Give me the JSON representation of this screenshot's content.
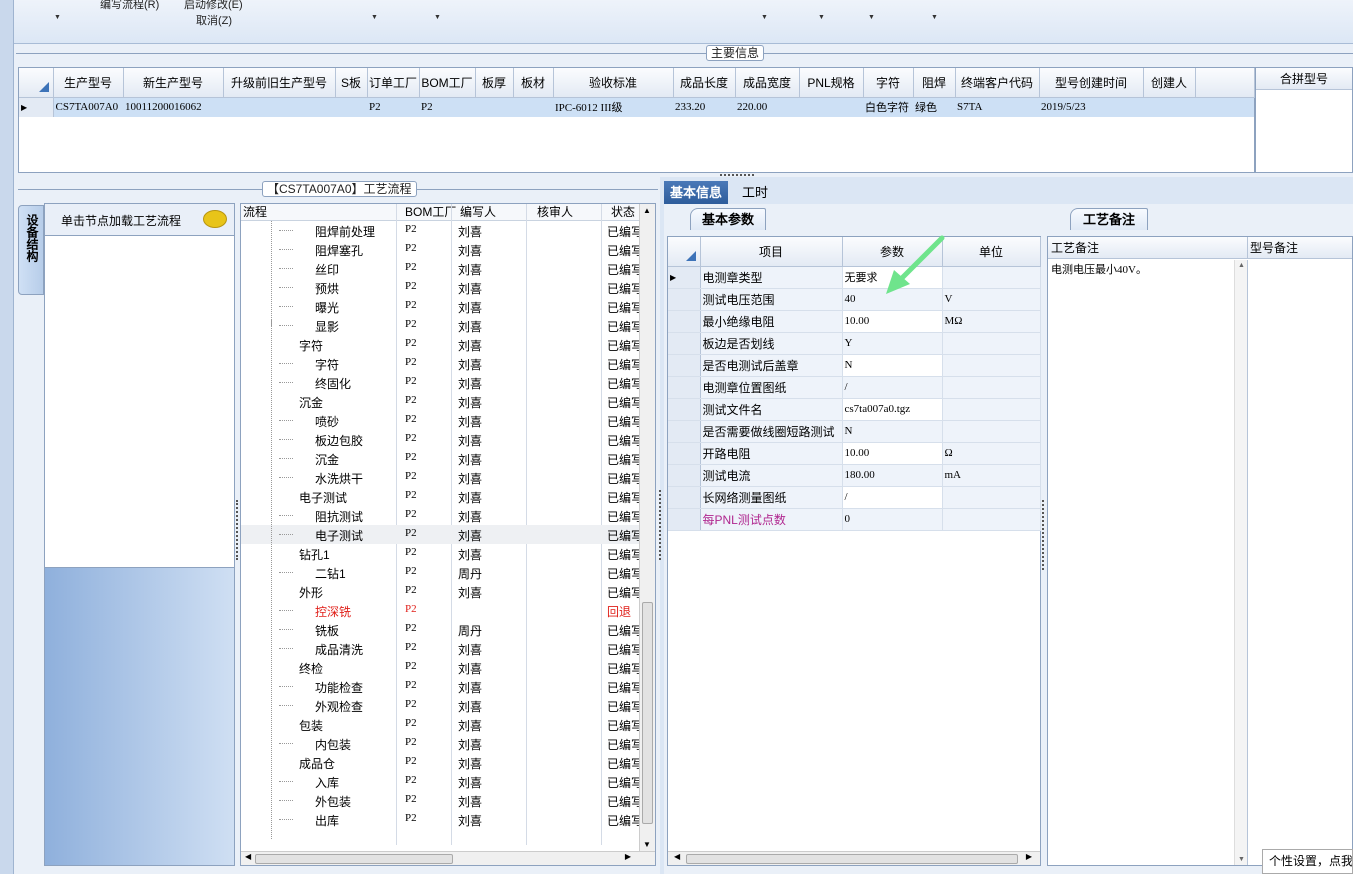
{
  "toolbar": {
    "items": [
      "编写流程(R)",
      "启动修改(E)",
      "取消(Z)"
    ]
  },
  "main_info": {
    "title": "主要信息",
    "columns": [
      "生产型号",
      "新生产型号",
      "升级前旧生产型号",
      "S板",
      "订单工厂",
      "BOM工厂",
      "板厚",
      "板材",
      "验收标准",
      "成品长度",
      "成品宽度",
      "PNL规格",
      "字符",
      "阻焊",
      "终端客户代码",
      "型号创建时间",
      "创建人"
    ],
    "rows": [
      [
        "CS7TA007A0",
        "10011200016062",
        "",
        "",
        "P2",
        "P2",
        "",
        "",
        "IPC-6012 III级",
        "233.20",
        "220.00",
        "",
        "白色字符",
        "绿色",
        "S7TA",
        "2019/5/23",
        ""
      ]
    ],
    "merge_title": "合拼型号"
  },
  "side_tab": "设备结构",
  "node_panel": {
    "header": "单击节点加载工艺流程"
  },
  "flow_panel": {
    "title": "【CS7TA007A0】工艺流程",
    "columns": [
      "流程",
      "BOM工厂",
      "编写人",
      "核审人",
      "状态"
    ],
    "rows": [
      {
        "name": "阻焊前处理",
        "level": 2,
        "type": "file",
        "bom": "P2",
        "writer": "刘喜",
        "reviewer": "",
        "status": "已编写",
        "red": false
      },
      {
        "name": "阻焊塞孔",
        "level": 2,
        "type": "file",
        "bom": "P2",
        "writer": "刘喜",
        "reviewer": "",
        "status": "已编写",
        "red": false
      },
      {
        "name": "丝印",
        "level": 2,
        "type": "file",
        "bom": "P2",
        "writer": "刘喜",
        "reviewer": "",
        "status": "已编写",
        "red": false
      },
      {
        "name": "预烘",
        "level": 2,
        "type": "file",
        "bom": "P2",
        "writer": "刘喜",
        "reviewer": "",
        "status": "已编写",
        "red": false
      },
      {
        "name": "曝光",
        "level": 2,
        "type": "file",
        "bom": "P2",
        "writer": "刘喜",
        "reviewer": "",
        "status": "已编写",
        "red": false
      },
      {
        "name": "显影",
        "level": 2,
        "type": "file",
        "bom": "P2",
        "writer": "刘喜",
        "reviewer": "",
        "status": "已编写",
        "red": false
      },
      {
        "name": "字符",
        "level": 1,
        "type": "folder",
        "bom": "P2",
        "writer": "刘喜",
        "reviewer": "",
        "status": "已编写",
        "red": false
      },
      {
        "name": "字符",
        "level": 2,
        "type": "file",
        "bom": "P2",
        "writer": "刘喜",
        "reviewer": "",
        "status": "已编写",
        "red": false
      },
      {
        "name": "终固化",
        "level": 2,
        "type": "file",
        "bom": "P2",
        "writer": "刘喜",
        "reviewer": "",
        "status": "已编写",
        "red": false
      },
      {
        "name": "沉金",
        "level": 1,
        "type": "folder",
        "bom": "P2",
        "writer": "刘喜",
        "reviewer": "",
        "status": "已编写",
        "red": false
      },
      {
        "name": "喷砂",
        "level": 2,
        "type": "file",
        "bom": "P2",
        "writer": "刘喜",
        "reviewer": "",
        "status": "已编写",
        "red": false
      },
      {
        "name": "板边包胶",
        "level": 2,
        "type": "file",
        "bom": "P2",
        "writer": "刘喜",
        "reviewer": "",
        "status": "已编写",
        "red": false
      },
      {
        "name": "沉金",
        "level": 2,
        "type": "file",
        "bom": "P2",
        "writer": "刘喜",
        "reviewer": "",
        "status": "已编写",
        "red": false
      },
      {
        "name": "水洗烘干",
        "level": 2,
        "type": "file",
        "bom": "P2",
        "writer": "刘喜",
        "reviewer": "",
        "status": "已编写",
        "red": false
      },
      {
        "name": "电子测试",
        "level": 1,
        "type": "folder",
        "bom": "P2",
        "writer": "刘喜",
        "reviewer": "",
        "status": "已编写",
        "red": false
      },
      {
        "name": "阻抗测试",
        "level": 2,
        "type": "file",
        "bom": "P2",
        "writer": "刘喜",
        "reviewer": "",
        "status": "已编写",
        "red": false
      },
      {
        "name": "电子测试",
        "level": 2,
        "type": "file",
        "bom": "P2",
        "writer": "刘喜",
        "reviewer": "",
        "status": "已编写",
        "red": false,
        "selected": true
      },
      {
        "name": "钻孔1",
        "level": 1,
        "type": "folder",
        "bom": "P2",
        "writer": "刘喜",
        "reviewer": "",
        "status": "已编写",
        "red": false
      },
      {
        "name": "二钻1",
        "level": 2,
        "type": "file",
        "bom": "P2",
        "writer": "周丹",
        "reviewer": "",
        "status": "已编写",
        "red": false
      },
      {
        "name": "外形",
        "level": 1,
        "type": "folder",
        "bom": "P2",
        "writer": "刘喜",
        "reviewer": "",
        "status": "已编写",
        "red": false
      },
      {
        "name": "控深铣",
        "level": 2,
        "type": "file",
        "bom": "P2",
        "writer": "",
        "reviewer": "",
        "status": "回退",
        "red": true
      },
      {
        "name": "铣板",
        "level": 2,
        "type": "file",
        "bom": "P2",
        "writer": "周丹",
        "reviewer": "",
        "status": "已编写",
        "red": false
      },
      {
        "name": "成品清洗",
        "level": 2,
        "type": "file",
        "bom": "P2",
        "writer": "刘喜",
        "reviewer": "",
        "status": "已编写",
        "red": false
      },
      {
        "name": "终检",
        "level": 1,
        "type": "folder",
        "bom": "P2",
        "writer": "刘喜",
        "reviewer": "",
        "status": "已编写",
        "red": false
      },
      {
        "name": "功能检查",
        "level": 2,
        "type": "file",
        "bom": "P2",
        "writer": "刘喜",
        "reviewer": "",
        "status": "已编写",
        "red": false
      },
      {
        "name": "外观检查",
        "level": 2,
        "type": "file",
        "bom": "P2",
        "writer": "刘喜",
        "reviewer": "",
        "status": "已编写",
        "red": false
      },
      {
        "name": "包装",
        "level": 1,
        "type": "folder",
        "bom": "P2",
        "writer": "刘喜",
        "reviewer": "",
        "status": "已编写",
        "red": false
      },
      {
        "name": "内包装",
        "level": 2,
        "type": "file",
        "bom": "P2",
        "writer": "刘喜",
        "reviewer": "",
        "status": "已编写",
        "red": false
      },
      {
        "name": "成品仓",
        "level": 1,
        "type": "folder",
        "bom": "P2",
        "writer": "刘喜",
        "reviewer": "",
        "status": "已编写",
        "red": false
      },
      {
        "name": "入库",
        "level": 2,
        "type": "file",
        "bom": "P2",
        "writer": "刘喜",
        "reviewer": "",
        "status": "已编写",
        "red": false
      },
      {
        "name": "外包装",
        "level": 2,
        "type": "file",
        "bom": "P2",
        "writer": "刘喜",
        "reviewer": "",
        "status": "已编写",
        "red": false
      },
      {
        "name": "出库",
        "level": 2,
        "type": "file",
        "bom": "P2",
        "writer": "刘喜",
        "reviewer": "",
        "status": "已编写",
        "red": false
      }
    ]
  },
  "tabs": [
    "基本信息",
    "工时"
  ],
  "basic_params": {
    "title": "基本参数",
    "columns": [
      "项目",
      "参数",
      "单位"
    ],
    "rows": [
      {
        "item": "电测章类型",
        "value": "无要求",
        "unit": "",
        "pink": false,
        "current": true
      },
      {
        "item": "测试电压范围",
        "value": "40",
        "unit": "V",
        "pink": false
      },
      {
        "item": "最小绝缘电阻",
        "value": "10.00",
        "unit": "MΩ",
        "pink": false
      },
      {
        "item": "板边是否划线",
        "value": "Y",
        "unit": "",
        "pink": false
      },
      {
        "item": "是否电测试后盖章",
        "value": "N",
        "unit": "",
        "pink": false
      },
      {
        "item": "电测章位置图纸",
        "value": "/",
        "unit": "",
        "pink": false
      },
      {
        "item": "测试文件名",
        "value": "cs7ta007a0.tgz",
        "unit": "",
        "pink": false
      },
      {
        "item": "是否需要做线圈短路测试",
        "value": "N",
        "unit": "",
        "pink": false
      },
      {
        "item": "开路电阻",
        "value": "10.00",
        "unit": "Ω",
        "pink": false
      },
      {
        "item": "测试电流",
        "value": "180.00",
        "unit": "mA",
        "pink": false
      },
      {
        "item": "长网络测量图纸",
        "value": "/",
        "unit": "",
        "pink": false
      },
      {
        "item": "每PNL测试点数",
        "value": "0",
        "unit": "",
        "pink": true
      }
    ]
  },
  "remarks": {
    "title": "工艺备注",
    "col1": "工艺备注",
    "col2": "型号备注",
    "text": "电测电压最小40V。"
  },
  "tooltip": "个性设置，点我"
}
